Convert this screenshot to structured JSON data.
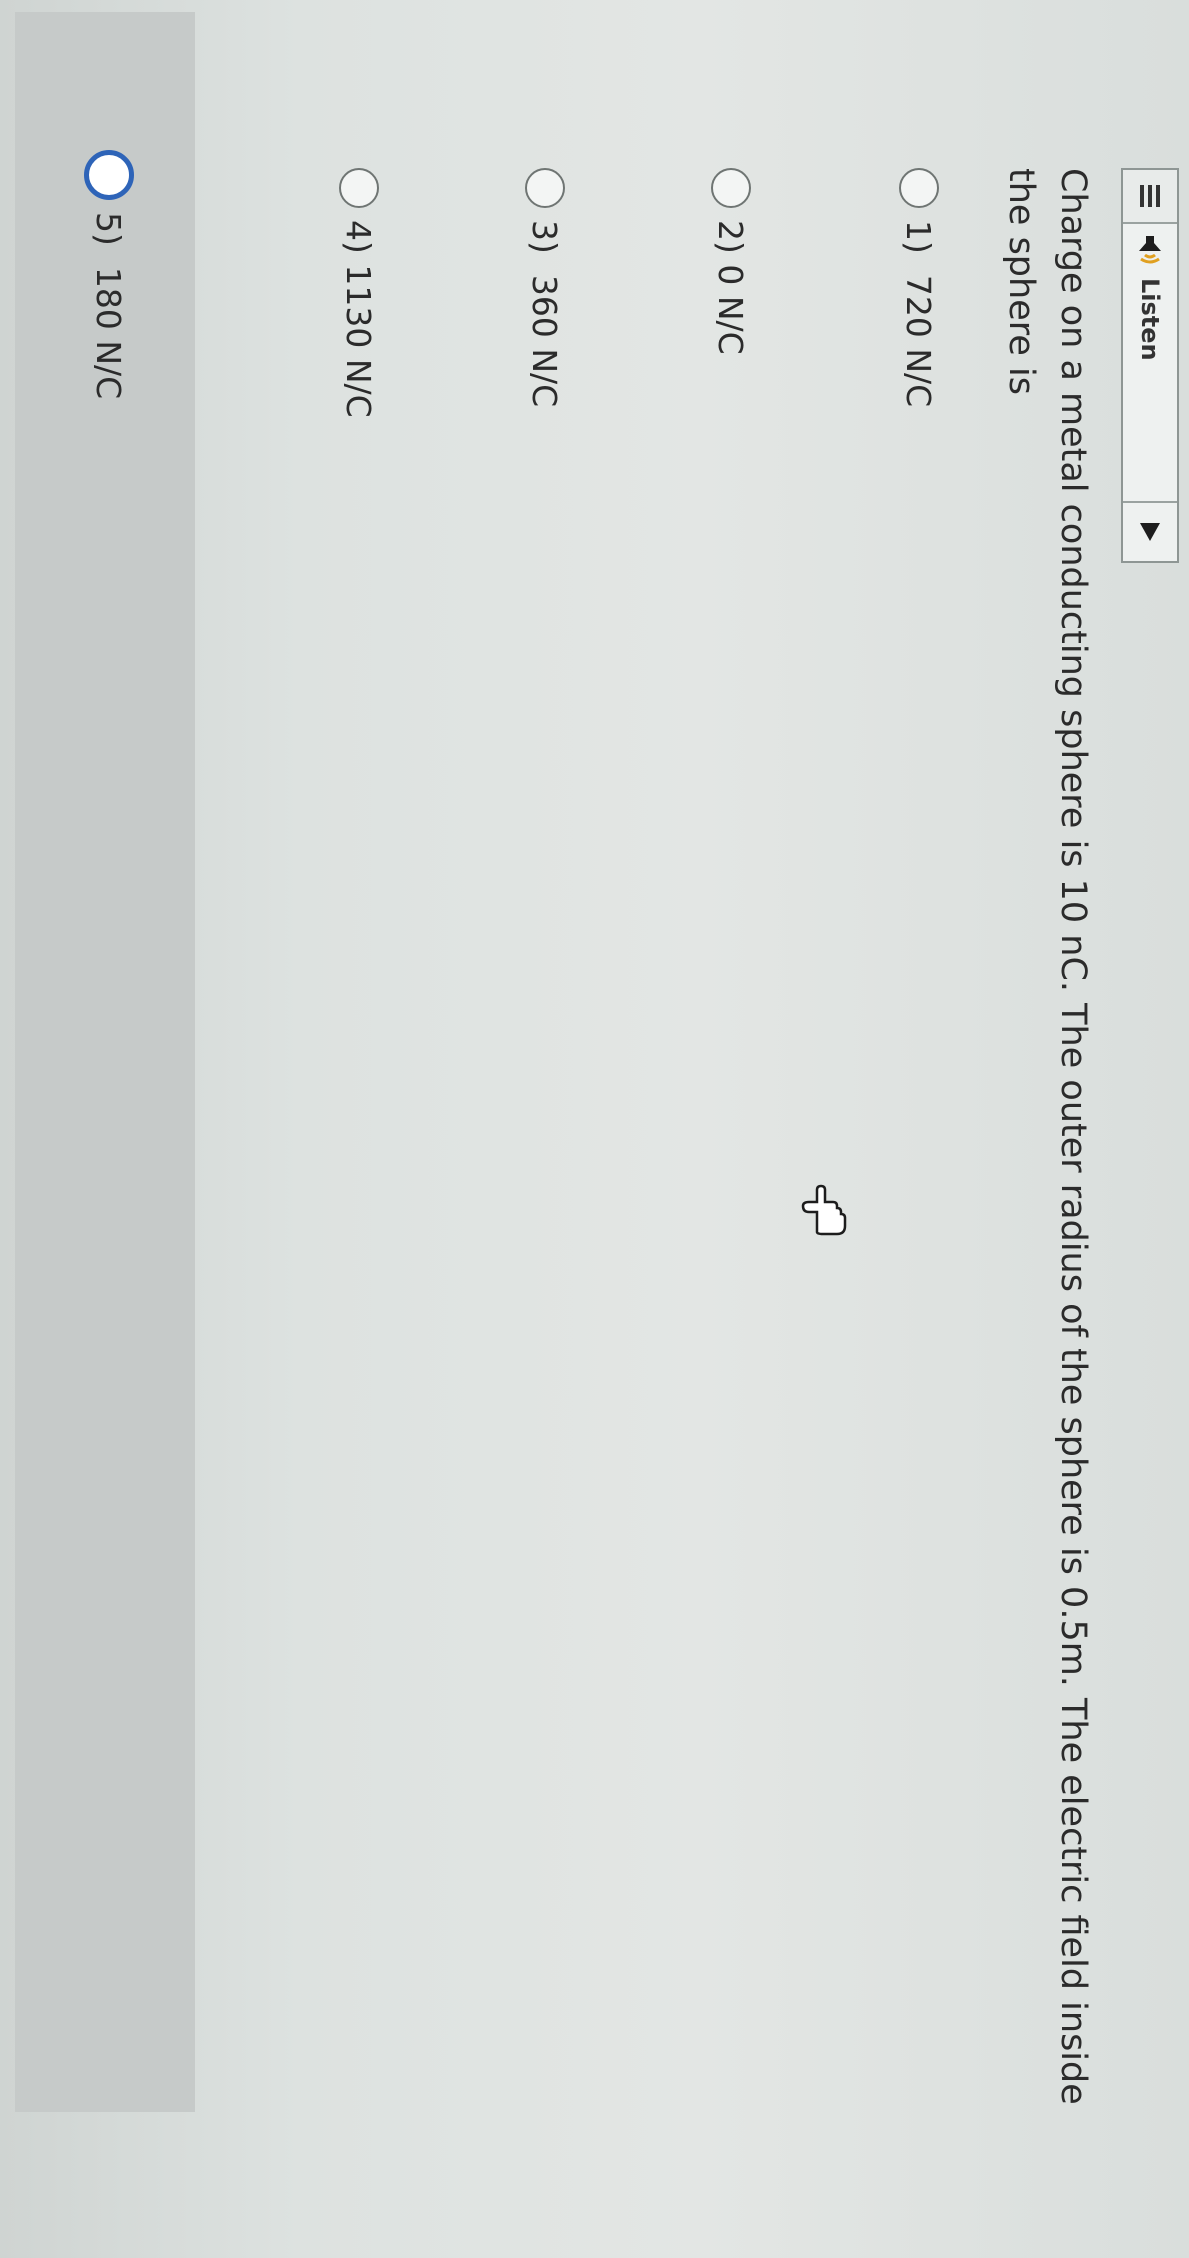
{
  "toolbar": {
    "menu_icon": "hamburger-icon",
    "listen_label": "Listen",
    "speaker_icon": "speaker-icon",
    "play_icon": "play-triangle-icon"
  },
  "question": {
    "text": "Charge on a metal conducting sphere is 10 nC. The outer radius of the sphere is 0.5m. The electric field inside the sphere is"
  },
  "options": [
    {
      "number": "1)",
      "label": "720 N/C"
    },
    {
      "number": "2)",
      "label": "0 N/C"
    },
    {
      "number": "3)",
      "label": "360 N/C"
    },
    {
      "number": "4)",
      "label": "1130 N/C"
    },
    {
      "number": "5)",
      "label": "180 N/C"
    }
  ],
  "highlighted_option_index": 5,
  "colors": {
    "selected_radio_border": "#2e64b8",
    "highlight_row": "#c6cac9"
  }
}
